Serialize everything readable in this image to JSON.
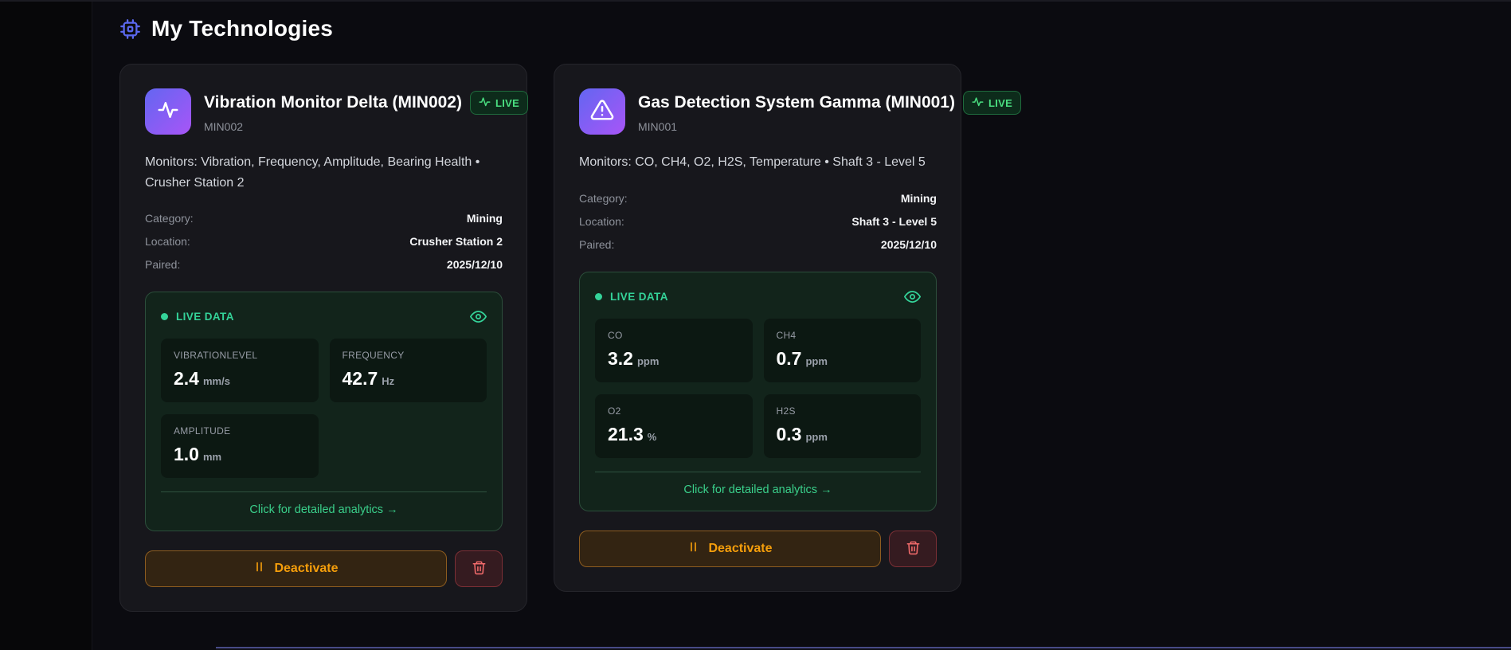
{
  "page": {
    "title": "My Technologies"
  },
  "colors": {
    "live_green": "#34d399",
    "badge_green": "#4ade80",
    "deactivate_amber": "#f59e0b",
    "delete_red": "#ef4444",
    "icon_gradient_start": "#6366f1",
    "icon_gradient_end": "#a855f7",
    "header_chip_blue": "#5b68ee"
  },
  "icons": {
    "header": "cpu-chip-icon",
    "card0": "activity-waveform-icon",
    "card1": "alert-triangle-icon",
    "badge": "pulse-icon",
    "panel": "eye-icon",
    "deactivate": "pause-icon",
    "delete": "trash-icon"
  },
  "cards": [
    {
      "title": "Vibration Monitor Delta (MIN002)",
      "device_id": "MIN002",
      "live_badge": "LIVE",
      "description": "Monitors: Vibration, Frequency, Amplitude, Bearing Health • Crusher Station 2",
      "details": [
        {
          "label": "Category:",
          "value": "Mining"
        },
        {
          "label": "Location:",
          "value": "Crusher Station 2"
        },
        {
          "label": "Paired:",
          "value": "2025/12/10"
        }
      ],
      "live_data": {
        "header": "LIVE DATA",
        "metrics": [
          {
            "label": "VIBRATIONLEVEL",
            "value": "2.4",
            "unit": "mm/s"
          },
          {
            "label": "FREQUENCY",
            "value": "42.7",
            "unit": "Hz"
          },
          {
            "label": "AMPLITUDE",
            "value": "1.0",
            "unit": "mm"
          }
        ],
        "analytics_link": "Click for detailed analytics →"
      },
      "actions": {
        "deactivate_label": "Deactivate"
      }
    },
    {
      "title": "Gas Detection System Gamma (MIN001)",
      "device_id": "MIN001",
      "live_badge": "LIVE",
      "description": "Monitors: CO, CH4, O2, H2S, Temperature • Shaft 3 - Level 5",
      "details": [
        {
          "label": "Category:",
          "value": "Mining"
        },
        {
          "label": "Location:",
          "value": "Shaft 3 - Level 5"
        },
        {
          "label": "Paired:",
          "value": "2025/12/10"
        }
      ],
      "live_data": {
        "header": "LIVE DATA",
        "metrics": [
          {
            "label": "CO",
            "value": "3.2",
            "unit": "ppm"
          },
          {
            "label": "CH4",
            "value": "0.7",
            "unit": "ppm"
          },
          {
            "label": "O2",
            "value": "21.3",
            "unit": "%"
          },
          {
            "label": "H2S",
            "value": "0.3",
            "unit": "ppm"
          }
        ],
        "analytics_link": "Click for detailed analytics →"
      },
      "actions": {
        "deactivate_label": "Deactivate"
      }
    }
  ]
}
